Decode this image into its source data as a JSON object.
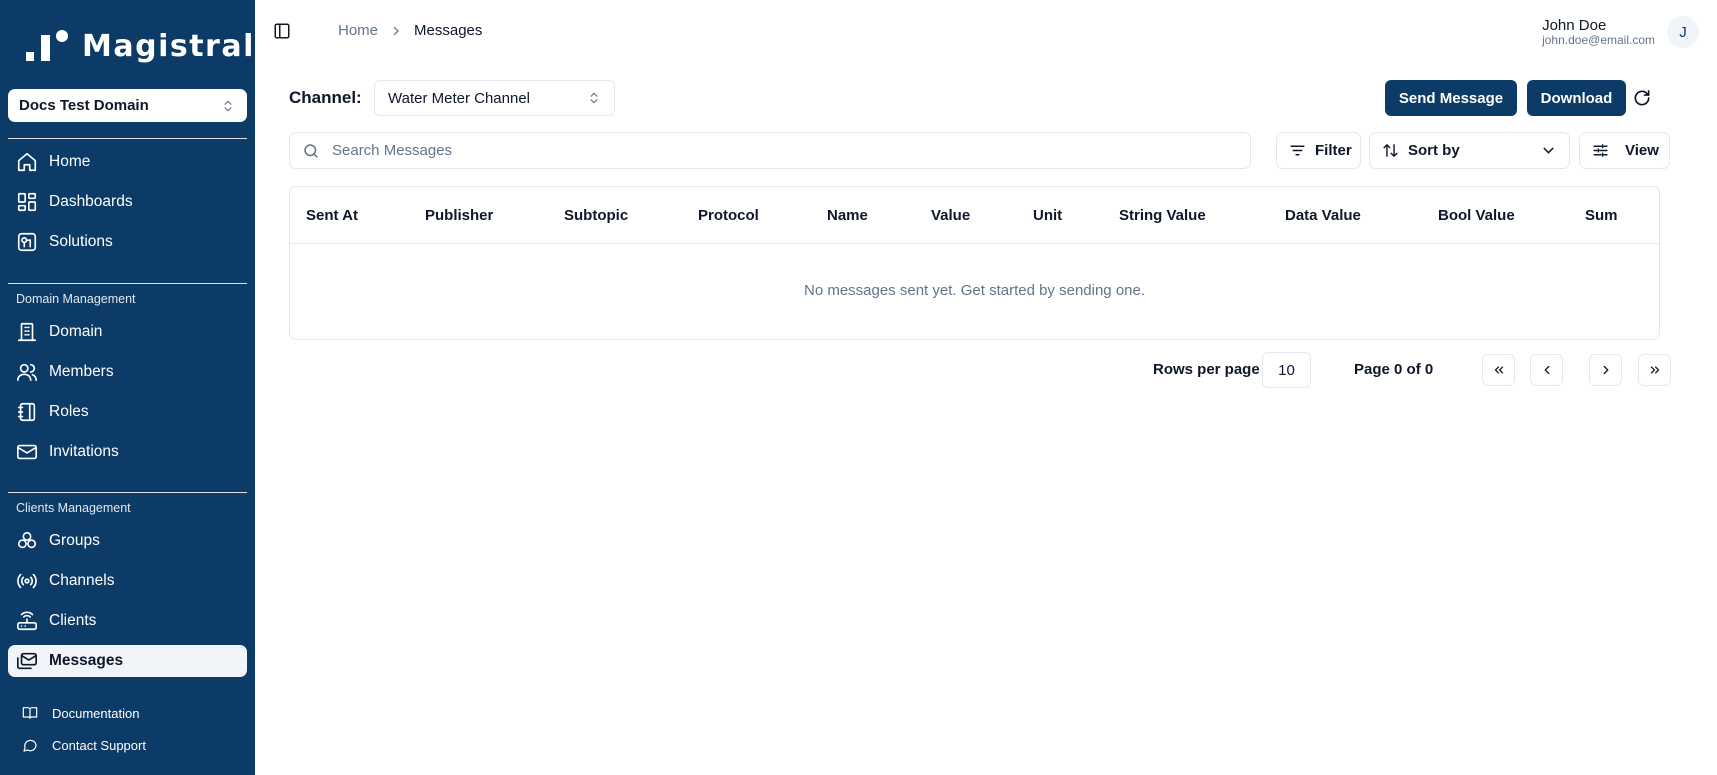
{
  "sidebar": {
    "logo_text": "Magistrala",
    "domain_select": "Docs Test Domain",
    "main_items": [
      {
        "label": "Home",
        "icon": "home-icon"
      },
      {
        "label": "Dashboards",
        "icon": "dashboard-icon"
      },
      {
        "label": "Solutions",
        "icon": "solutions-icon"
      }
    ],
    "domain_section": "Domain Management",
    "domain_items": [
      {
        "label": "Domain",
        "icon": "building-icon"
      },
      {
        "label": "Members",
        "icon": "users-icon"
      },
      {
        "label": "Roles",
        "icon": "notebook-icon"
      },
      {
        "label": "Invitations",
        "icon": "mail-icon"
      }
    ],
    "clients_section": "Clients Management",
    "clients_items": [
      {
        "label": "Groups",
        "icon": "groups-icon"
      },
      {
        "label": "Channels",
        "icon": "radio-icon"
      },
      {
        "label": "Clients",
        "icon": "router-icon"
      },
      {
        "label": "Messages",
        "icon": "messages-icon",
        "active": true
      }
    ],
    "footer_items": [
      {
        "label": "Documentation",
        "icon": "book-icon"
      },
      {
        "label": "Contact Support",
        "icon": "chat-icon"
      }
    ]
  },
  "header": {
    "breadcrumb": [
      "Home",
      "Messages"
    ],
    "user_name": "John Doe",
    "user_email": "john.doe@email.com",
    "avatar_initial": "J"
  },
  "toolbar": {
    "channel_label": "Channel:",
    "channel_value": "Water Meter Channel",
    "send_label": "Send Message",
    "download_label": "Download",
    "search_placeholder": "Search Messages",
    "filter_label": "Filter",
    "sort_label": "Sort by",
    "view_label": "View"
  },
  "table": {
    "columns": [
      "Sent At",
      "Publisher",
      "Subtopic",
      "Protocol",
      "Name",
      "Value",
      "Unit",
      "String Value",
      "Data Value",
      "Bool Value",
      "Sum"
    ],
    "empty_text": "No messages sent yet. Get started by sending one."
  },
  "pagination": {
    "rows_label": "Rows per page",
    "rows_value": "10",
    "page_label": "Page 0 of 0"
  },
  "colors": {
    "sidebar_bg": "#0b3b66",
    "primary": "#0b3b66",
    "border": "#e2e8f0",
    "muted_text": "#64748b"
  }
}
